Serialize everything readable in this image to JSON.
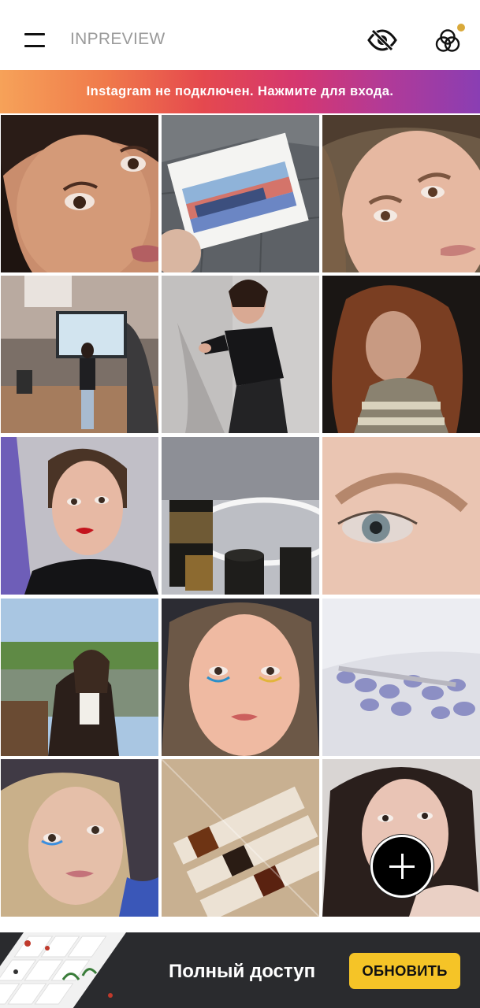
{
  "header": {
    "app_title": "INPREVIEW",
    "menu_icon": "hamburger-menu-icon",
    "visibility_icon": "eye-off-icon",
    "filters_icon": "venn-circles-icon",
    "notification_dot_color": "#d9a93a"
  },
  "banner": {
    "text": "Instagram не подключен. Нажмите для входа."
  },
  "grid": {
    "columns": 3,
    "rows": 5,
    "tiles": [
      "portrait-eyes-closeup",
      "watercolor-postcard",
      "portrait-brows",
      "presentation-stage",
      "woman-blowing-kiss",
      "curly-hair-portrait",
      "red-lips-portrait",
      "cosmetic-bottles",
      "eye-macro",
      "lakeside-portrait",
      "colorful-eyeliner-portrait",
      "blue-wax-beads",
      "blue-eyeliner-portrait",
      "packaged-dyes",
      "dark-hair-portrait"
    ]
  },
  "fab": {
    "icon": "plus-icon"
  },
  "promo": {
    "title": "Полный доступ",
    "button_label": "ОБНОВИТЬ",
    "button_color": "#f5c427"
  }
}
